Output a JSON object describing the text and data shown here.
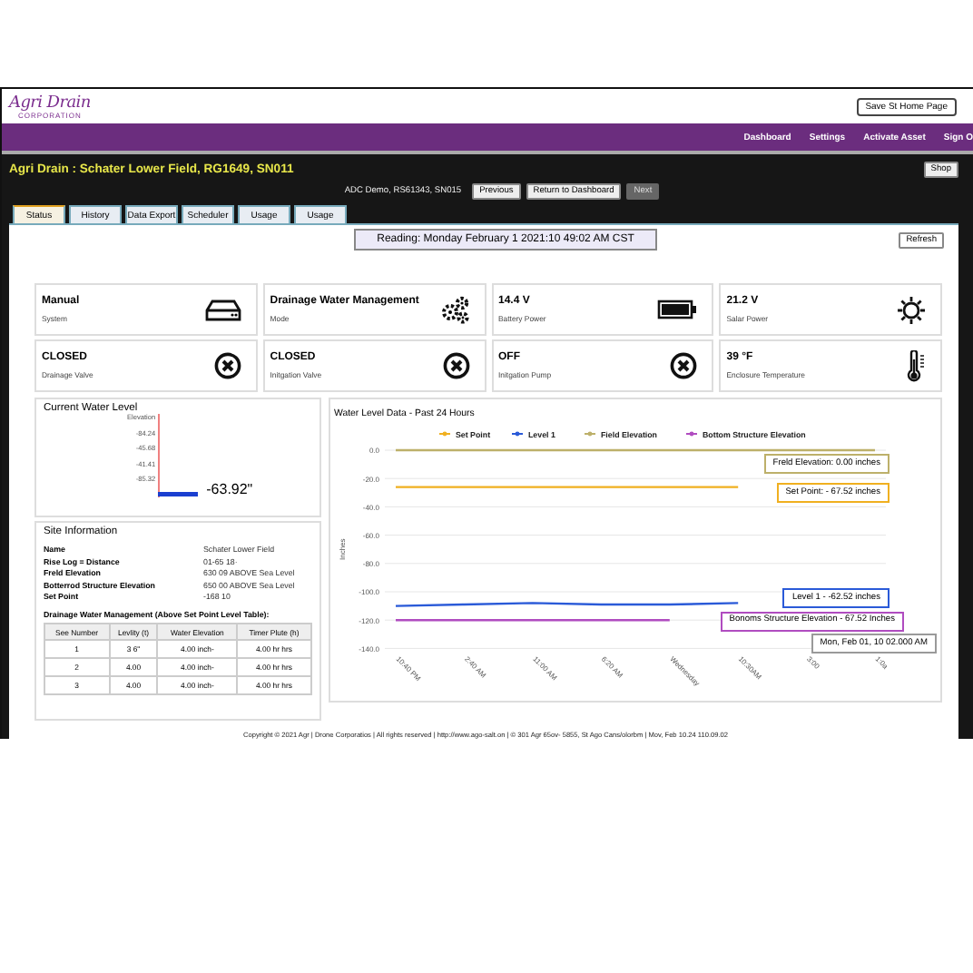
{
  "logo": {
    "name": "Agri Drain",
    "tagline": "CORPORATION"
  },
  "header_button": "Save St Home Page",
  "nav": [
    "Dashboard",
    "Settings",
    "Activate Asset",
    "Sign O"
  ],
  "site_title": "Agri Drain : Schater Lower Field, RG1649, SN011",
  "shop_button": "Shop",
  "device": "ADC Demo, RS61343, SN015",
  "device_buttons": [
    {
      "label": "Previous",
      "disabled": false
    },
    {
      "label": "Return to Dashboard",
      "disabled": false
    },
    {
      "label": "Next",
      "disabled": true
    }
  ],
  "tabs": [
    {
      "label": "Status",
      "selected": true
    },
    {
      "label": "History",
      "selected": false
    },
    {
      "label": "Data Export",
      "selected": false
    },
    {
      "label": "Scheduler",
      "selected": false
    },
    {
      "label": "Usage",
      "selected": false
    },
    {
      "label": "Usage",
      "selected": false
    }
  ],
  "reading": "Reading: Monday  February 1  2021:10 49:02 AM CST",
  "refresh_button": "Refresh",
  "cards": [
    {
      "value": "Manual",
      "label": "System"
    },
    {
      "value": "Drainage Water Management",
      "label": "Mode"
    },
    {
      "value": "14.4 V",
      "label": "Battery Power"
    },
    {
      "value": "21.2 V",
      "label": "Salar Power"
    },
    {
      "value": "CLOSED",
      "label": "Drainage Valve"
    },
    {
      "value": "CLOSED",
      "label": "Initgation Valve"
    },
    {
      "value": "OFF",
      "label": "Initgation Pump"
    },
    {
      "value": "39 °F",
      "label": "Enclosure Temperature"
    }
  ],
  "water_level": {
    "title": "Current Water Level",
    "axis_title": "Elevation",
    "axis_labels": [
      "-84.24",
      "-45.68",
      "-41.41",
      "-85.32"
    ],
    "reading": "-63.92\""
  },
  "site_info": {
    "title": "Site Information",
    "rows": [
      {
        "label": "Name",
        "value": "Schater Lower Field"
      },
      {
        "label": "Rise Log = Distance",
        "value": "01-65 18·"
      },
      {
        "label": "Freld Elevation",
        "value": "630 09 ABOVE Sea Level"
      },
      {
        "label": "Botterrod Structure Elevation",
        "value": "650 00 ABOVE Sea Level"
      },
      {
        "label": "Set Point",
        "value": "-168 10"
      }
    ]
  },
  "dwm_table": {
    "title": "Drainage Water Management (Above Set Point Level Table):",
    "columns": [
      "See Number",
      "Levlity (t)",
      "Water Elevation",
      "Timer Plute (h)"
    ],
    "rows": [
      [
        "1",
        "3 6\"",
        "4.00 inch-",
        "4.00 hr hrs"
      ],
      [
        "2",
        "4.00",
        "4.00 inch-",
        "4.00 hr hrs"
      ],
      [
        "3",
        "4.00",
        "4.00 inch-",
        "4.00 hr hrs"
      ]
    ]
  },
  "chart": {
    "chart_data": {
      "type": "line",
      "title": "Water Level Data - Past 24 Hours",
      "ylabel": "Inches",
      "categories": [
        "10:40 PM",
        "2:40 AM",
        "11:00 AM",
        "6:20 AM",
        "Wednesday",
        "10:30AM",
        "3:00",
        "1:0a"
      ],
      "series": [
        {
          "name": "Set Point",
          "color": "#f0b020",
          "values": [
            -26,
            -26,
            -26,
            -26,
            -26,
            -26,
            null,
            null
          ]
        },
        {
          "name": "Level 1",
          "color": "#2a5ad8",
          "values": [
            -110,
            -109,
            -108,
            -109,
            -109,
            -108,
            null,
            null
          ]
        },
        {
          "name": "Field Elevation",
          "color": "#bdb06a",
          "values": [
            0,
            0,
            0,
            0,
            0,
            0,
            0,
            0
          ]
        },
        {
          "name": "Bottom Structure Elevation",
          "color": "#b04cc0",
          "values": [
            -120,
            -120,
            -120,
            -120,
            -120,
            null,
            null,
            null
          ]
        }
      ],
      "grid": true,
      "legend": true,
      "ylim": [
        -140,
        0
      ],
      "yticks": [
        {
          "value": 0,
          "label": "0.0"
        },
        {
          "value": -20,
          "label": "-20.0"
        },
        {
          "value": -40,
          "label": "-40.0"
        },
        {
          "value": -60,
          "label": "-60.0"
        },
        {
          "value": -80,
          "label": "-80.0"
        },
        {
          "value": -100,
          "label": "-100.0"
        },
        {
          "value": -120,
          "label": "-120.0"
        },
        {
          "value": -140,
          "label": "-140.0"
        }
      ],
      "annotations": [
        "Freld Elevation: 0.00 inches",
        "Set Point: - 67.52 inches",
        "Level 1 - -62.52 inches",
        "Bonoms Structure Elevation - 67.52 Inches",
        "Mon, Feb 01, 10 02.000 AM"
      ]
    }
  },
  "footer": "Copyright © 2021 Agr | Drone Corporatios | All rights reserved | http://www.ago-salt.on | © 301 Agr 65ov- 5855, St Ago Cans/olorbm | Mov, Feb 10.24 110.09.02"
}
